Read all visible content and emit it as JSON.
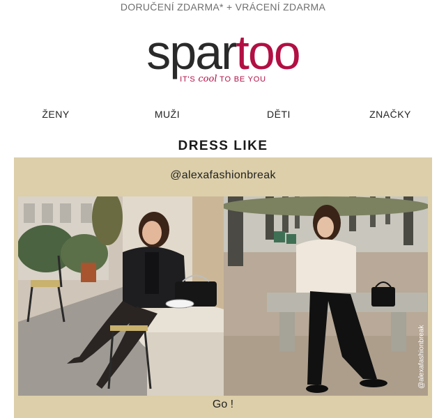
{
  "topbar": {
    "text": "DORUČENÍ ZDARMA* + VRÁCENÍ ZDARMA"
  },
  "logo": {
    "part1": "spar",
    "part2": "too"
  },
  "tagline": {
    "pre": "IT'S ",
    "cool": "cool",
    "post": " TO BE YOU"
  },
  "nav": [
    "ŽENY",
    "MUŽI",
    "DĚTI",
    "ZNAČKY"
  ],
  "section": {
    "title": "DRESS LIKE"
  },
  "influencer": {
    "handle": "@alexafashionbreak",
    "watermark": "@alexafashionbreak",
    "cta": "Go !"
  },
  "colors": {
    "brand": "#b20f44",
    "panel": "#dccfa9"
  },
  "photos": [
    {
      "icon": "photo-cafe-terrace"
    },
    {
      "icon": "photo-park-bench"
    }
  ]
}
